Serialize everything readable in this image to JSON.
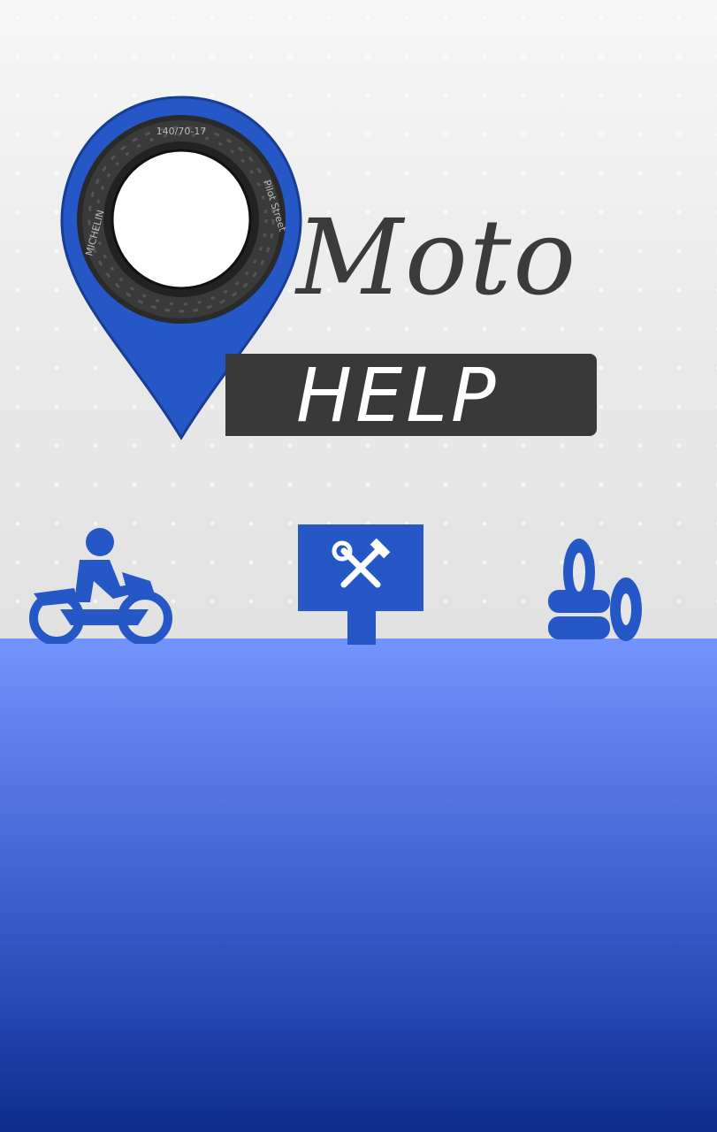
{
  "brand": {
    "word_top": "Moto",
    "word_bottom": "HELP",
    "tyre_text_top": "140/70-17",
    "tyre_text_left": "MICHELIN",
    "tyre_text_right": "Pilot Street",
    "logo_icon": "map-pin-tyre-icon"
  },
  "services": [
    {
      "icon": "motorcycle-rider-icon"
    },
    {
      "icon": "repair-shop-sign-icon"
    },
    {
      "icon": "tyres-stack-icon"
    }
  ],
  "colors": {
    "brand_blue": "#2557c7",
    "dark_gray": "#393939",
    "gradient_top": "#7394fd",
    "gradient_bottom": "#0c2b8a"
  }
}
